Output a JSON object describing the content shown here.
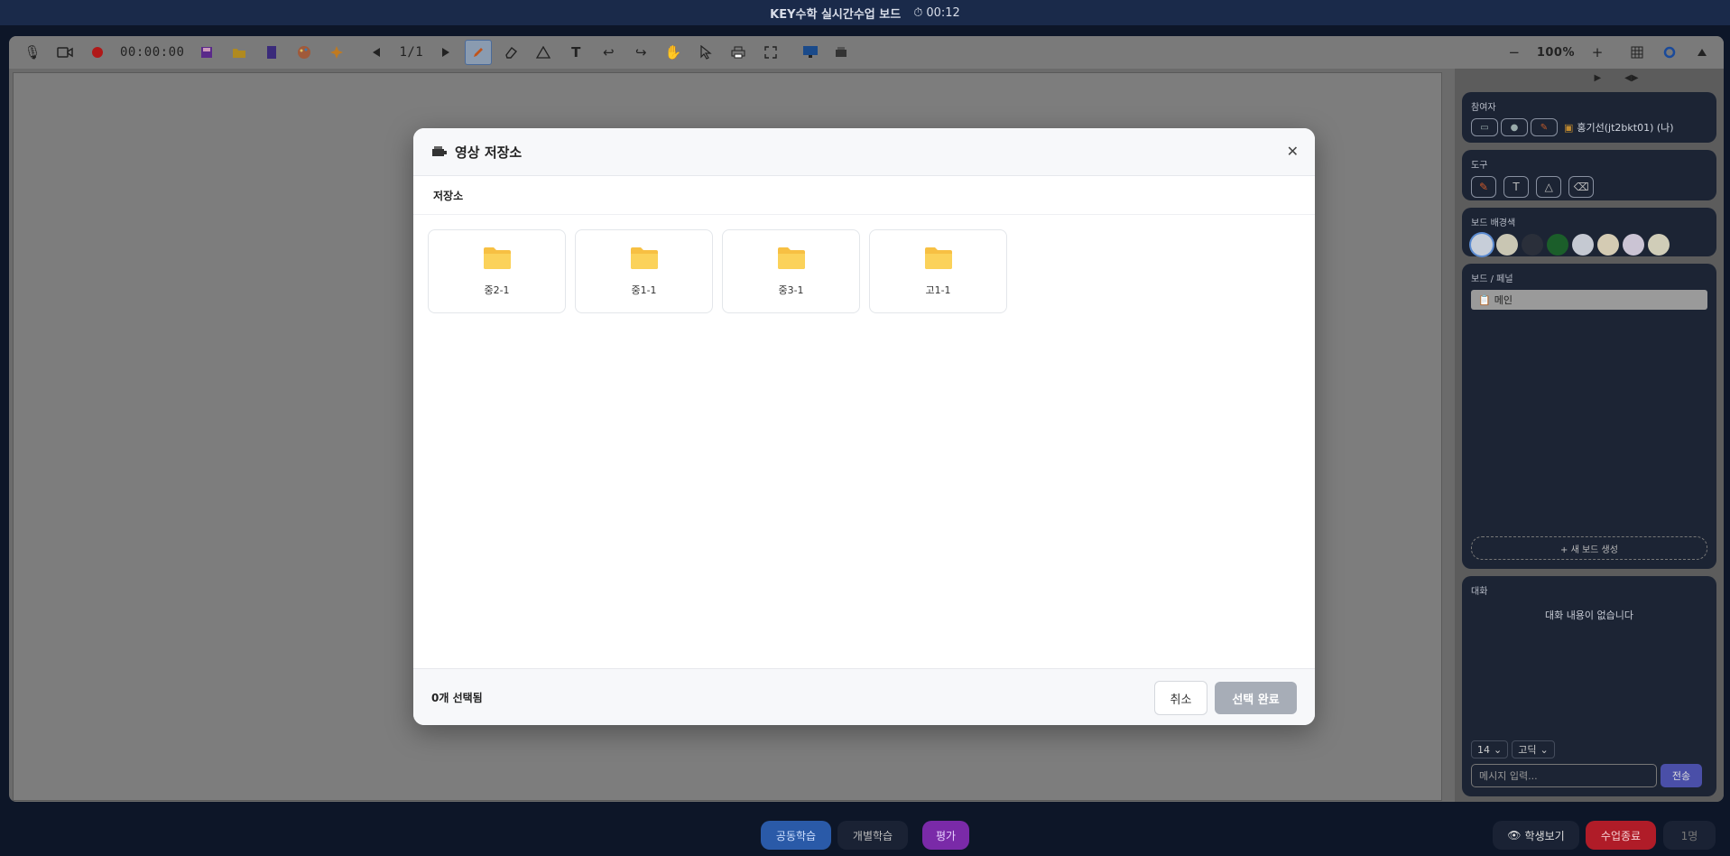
{
  "titlebar": {
    "title": "KEY수학 실시간수업 보드",
    "timer": "00:12"
  },
  "toolbar": {
    "record_time": "00:00:00",
    "page_indicator": "1/1",
    "zoom": "100%",
    "zoom_out": "−",
    "zoom_in": "+"
  },
  "right_panel": {
    "participants": {
      "title": "참여자",
      "user": "홍기선(jt2bkt01) (나)"
    },
    "tools": {
      "title": "도구"
    },
    "board_colors": {
      "title": "보드 배경색",
      "colors": [
        "#c7ced9",
        "#c9c6b3",
        "#2a2f3a",
        "#1b5e2a",
        "#c5c9d2",
        "#d4cbb3",
        "#cbc4d4",
        "#d0cdb8"
      ]
    },
    "boards": {
      "title": "보드 / 페널",
      "items": [
        "메인"
      ],
      "new_board": "+ 새 보드 생성"
    },
    "chat": {
      "title": "대화",
      "empty": "대화 내용이 없습니다",
      "font_size": "14",
      "font_family": "고딕",
      "placeholder": "메시지 입력...",
      "send": "전송"
    }
  },
  "bottom": {
    "tab_common": "공동학습",
    "tab_individual": "개별학습",
    "tab_eval": "평가",
    "student_view": "학생보기",
    "end_class": "수업종료",
    "count": "1명"
  },
  "modal": {
    "title": "영상 저장소",
    "breadcrumb": "저장소",
    "folders": [
      "중2-1",
      "중1-1",
      "중3-1",
      "고1-1"
    ],
    "selected_count": "0개 선택됨",
    "cancel": "취소",
    "confirm": "선택 완료"
  }
}
